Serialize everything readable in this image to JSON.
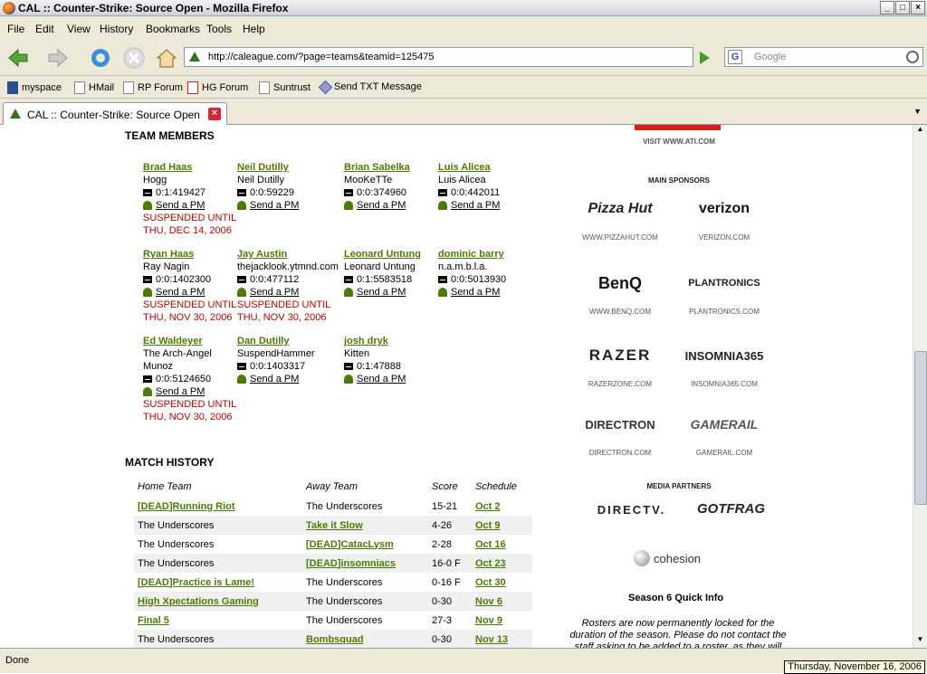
{
  "window": {
    "title": "CAL :: Counter-Strike: Source Open - Mozilla Firefox"
  },
  "menu": [
    "File",
    "Edit",
    "View",
    "History",
    "Bookmarks",
    "Tools",
    "Help"
  ],
  "url": "http://caleague.com/?page=teams&teamid=125475",
  "search_placeholder": "Google",
  "bookmarks": [
    "myspace",
    "HMail",
    "RP Forum",
    "HG Forum",
    "Suntrust",
    "Send TXT Message"
  ],
  "tab": {
    "label": "CAL :: Counter-Strike: Source Open"
  },
  "status": {
    "text": "Done",
    "date": "Thursday, November 16, 2006"
  },
  "team": {
    "heading": "TEAM MEMBERS",
    "send_pm": "Send a PM",
    "members": [
      {
        "name": "Brad Haas",
        "alias": "Hogg",
        "id": "0:1:419427",
        "s1": "SUSPENDED UNTIL",
        "s2": "THU, DEC 14, 2006"
      },
      {
        "name": "Neil Dutilly",
        "alias": "Neil Dutilly",
        "id": "0:0:59229",
        "s1": "",
        "s2": ""
      },
      {
        "name": "Brian Sabelka",
        "alias": "MooKeTTe",
        "id": "0:0:374960",
        "s1": "",
        "s2": ""
      },
      {
        "name": "Luis Alicea",
        "alias": "Luis Alicea",
        "id": "0:0:442011",
        "s1": "",
        "s2": ""
      },
      {
        "name": "Ryan Haas",
        "alias": "Ray Nagin",
        "id": "0:0:1402300",
        "s1": "SUSPENDED UNTIL",
        "s2": "THU, NOV 30, 2006"
      },
      {
        "name": "Jay Austin",
        "alias": "thejacklook.ytmnd.com",
        "id": "0:0:477112",
        "s1": "SUSPENDED UNTIL",
        "s2": "THU, NOV 30, 2006"
      },
      {
        "name": "Leonard Untung",
        "alias": "Leonard Untung",
        "id": "0:1:5583518",
        "s1": "",
        "s2": ""
      },
      {
        "name": "dominic barry",
        "alias": "n.a.m.b.l.a.",
        "id": "0:0:5013930",
        "s1": "",
        "s2": ""
      },
      {
        "name": "Ed Waldeyer",
        "alias": "The Arch-Angel Munoz",
        "id": "0:0:5124650",
        "s1": "SUSPENDED UNTIL",
        "s2": "THU, NOV 30, 2006"
      },
      {
        "name": "Dan Dutilly",
        "alias": "SuspendHammer",
        "id": "0:0:1403317",
        "s1": "",
        "s2": ""
      },
      {
        "name": "josh dryk",
        "alias": "Kitten",
        "id": "0:1:47888",
        "s1": "",
        "s2": ""
      }
    ]
  },
  "matches": {
    "heading": "MATCH HISTORY",
    "cols": [
      "Home Team",
      "Away Team",
      "Score",
      "Schedule"
    ],
    "rows": [
      [
        "[DEAD]Running Riot",
        "The Underscores",
        "15-21",
        "Oct 2"
      ],
      [
        "The Underscores",
        "Take it Slow",
        "4-26",
        "Oct 9"
      ],
      [
        "The Underscores",
        "[DEAD]CatacLysm",
        "2-28",
        "Oct 16"
      ],
      [
        "The Underscores",
        "[DEAD]insomniacs",
        "16-0 F",
        "Oct 23"
      ],
      [
        "[DEAD]Practice is Lame!",
        "The Underscores",
        "0-16 F",
        "Oct 30"
      ],
      [
        "High Xpectations Gaming",
        "The Underscores",
        "0-30",
        "Nov 6"
      ],
      [
        "Final 5",
        "The Underscores",
        "27-3",
        "Nov 9"
      ],
      [
        "The Underscores",
        "Bombsquad",
        "0-30",
        "Nov 13"
      ]
    ]
  },
  "sidebar": {
    "visit": "VISIT WWW.ATI.COM",
    "main_sponsors": "MAIN SPONSORS",
    "sponsors": [
      {
        "logo": "Pizza Hut",
        "url": "WWW.PIZZAHUT.COM"
      },
      {
        "logo": "verizon",
        "url": "VERIZON.COM"
      },
      {
        "logo": "BenQ",
        "url": "WWW.BENQ.COM"
      },
      {
        "logo": "PLANTRONICS",
        "url": "PLANTRONICS.COM"
      },
      {
        "logo": "RAZER",
        "url": "RAZERZONE.COM"
      },
      {
        "logo": "INSOMNIA365",
        "url": "INSOMNIA365.COM"
      },
      {
        "logo": "DIRECTRON",
        "url": "DIRECTRON.COM"
      },
      {
        "logo": "GAMERAIL",
        "url": "GAMERAIL.COM"
      }
    ],
    "media_partners": "MEDIA PARTNERS",
    "media": [
      "DIRECTV.",
      "GOTFRAG",
      "cohesion"
    ],
    "quick_info_title": "Season 6 Quick Info",
    "quick_info_text": "Rosters are now permanently locked for the duration of the season. Please do not contact the staff asking to be added to a roster, as they will"
  },
  "colors": {
    "link": "#4c7a05",
    "suspended": "#bb0000",
    "ati_red": "#d62020"
  }
}
